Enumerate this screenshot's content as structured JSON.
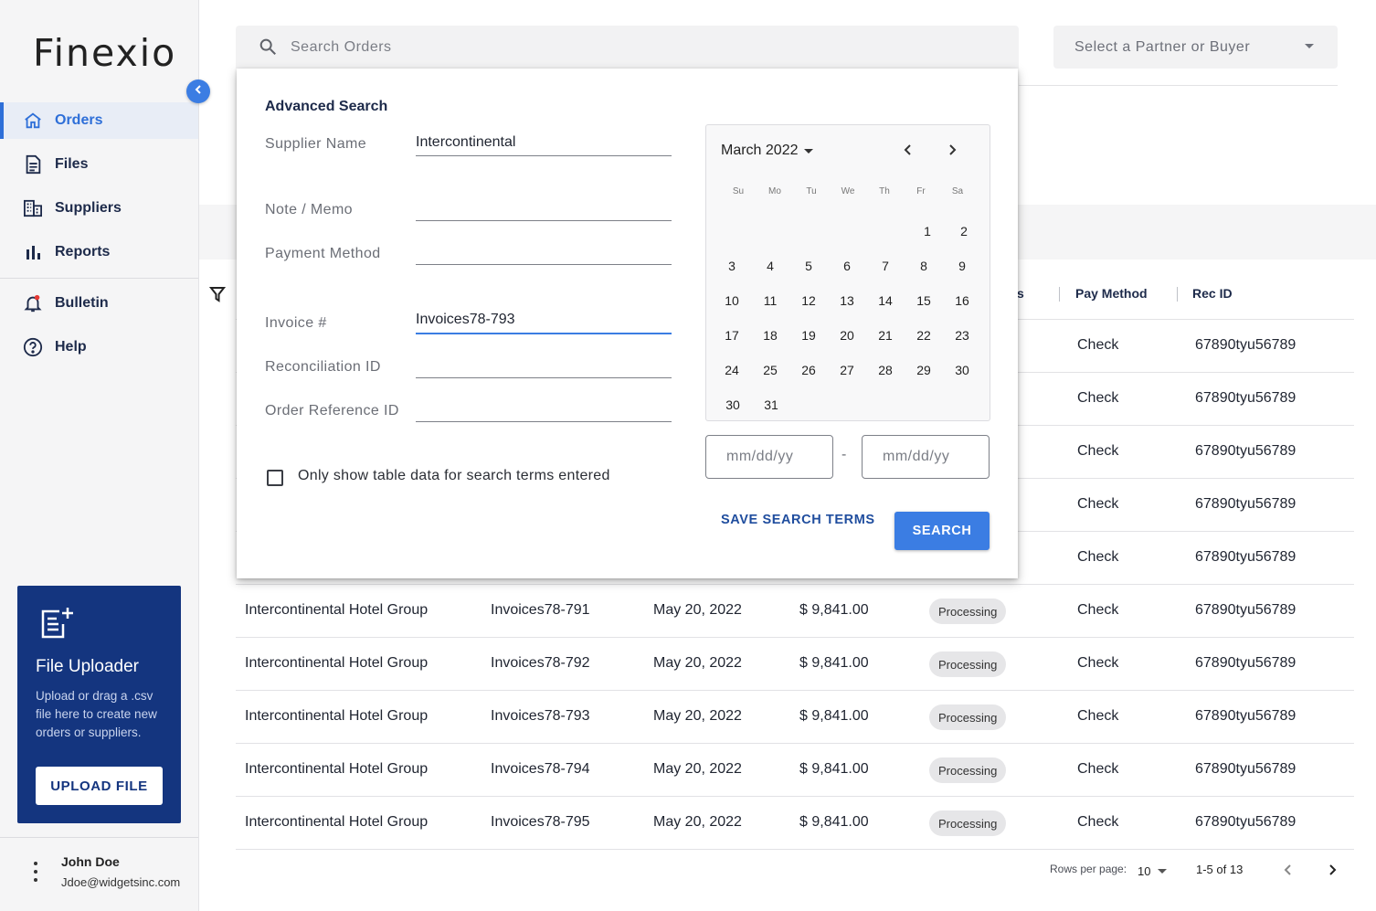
{
  "app": {
    "logo": "Finexio"
  },
  "sidebar": {
    "items": [
      {
        "label": "Orders",
        "icon": "home-icon"
      },
      {
        "label": "Files",
        "icon": "file-icon"
      },
      {
        "label": "Suppliers",
        "icon": "building-icon"
      },
      {
        "label": "Reports",
        "icon": "bar-chart-icon"
      },
      {
        "label": "Bulletin",
        "icon": "bell-icon"
      },
      {
        "label": "Help",
        "icon": "help-icon"
      }
    ],
    "active": "Orders"
  },
  "uploader": {
    "title": "File Uploader",
    "description": "Upload or drag a .csv file here to create new orders or suppliers.",
    "button": "UPLOAD FILE"
  },
  "user": {
    "name": "John Doe",
    "email": "Jdoe@widgetsinc.com"
  },
  "search": {
    "placeholder": "Search Orders"
  },
  "partner": {
    "placeholder": "Select a Partner or Buyer"
  },
  "table": {
    "headers": [
      "s",
      "Pay Method",
      "Rec ID"
    ],
    "partial_rows": [
      {
        "pay_method": "Check",
        "rec_id": "67890tyu56789"
      },
      {
        "pay_method": "Check",
        "rec_id": "67890tyu56789"
      },
      {
        "pay_method": "Check",
        "rec_id": "67890tyu56789"
      },
      {
        "pay_method": "Check",
        "rec_id": "67890tyu56789"
      },
      {
        "pay_method": "Check",
        "rec_id": "67890tyu56789"
      }
    ],
    "rows": [
      {
        "supplier": "Intercontinental Hotel Group",
        "invoice": "Invoices78-791",
        "date": "May 20, 2022",
        "amount": "$ 9,841.00",
        "status": "Processing",
        "pay_method": "Check",
        "rec_id": "67890tyu56789"
      },
      {
        "supplier": "Intercontinental Hotel Group",
        "invoice": "Invoices78-792",
        "date": "May 20, 2022",
        "amount": "$ 9,841.00",
        "status": "Processing",
        "pay_method": "Check",
        "rec_id": "67890tyu56789"
      },
      {
        "supplier": "Intercontinental Hotel Group",
        "invoice": "Invoices78-793",
        "date": "May 20, 2022",
        "amount": "$ 9,841.00",
        "status": "Processing",
        "pay_method": "Check",
        "rec_id": "67890tyu56789"
      },
      {
        "supplier": "Intercontinental Hotel Group",
        "invoice": "Invoices78-794",
        "date": "May 20, 2022",
        "amount": "$ 9,841.00",
        "status": "Processing",
        "pay_method": "Check",
        "rec_id": "67890tyu56789"
      },
      {
        "supplier": "Intercontinental Hotel Group",
        "invoice": "Invoices78-795",
        "date": "May 20, 2022",
        "amount": "$ 9,841.00",
        "status": "Processing",
        "pay_method": "Check",
        "rec_id": "67890tyu56789"
      }
    ]
  },
  "pagination": {
    "rows_label": "Rows per page:",
    "rows_value": "10",
    "range": "1-5 of 13"
  },
  "advanced": {
    "title": "Advanced Search",
    "fields": [
      {
        "label": "Supplier Name",
        "value": "Intercontinental"
      },
      {
        "label": "Note / Memo",
        "value": ""
      },
      {
        "label": "Payment Method",
        "value": ""
      },
      {
        "label": "Invoice #",
        "value": "Invoices78-793"
      },
      {
        "label": "Reconciliation ID",
        "value": ""
      },
      {
        "label": "Order Reference ID",
        "value": ""
      }
    ],
    "checkbox_label": "Only show table data for search terms entered",
    "calendar": {
      "month": "March 2022",
      "weekdays": [
        "Su",
        "Mo",
        "Tu",
        "We",
        "Th",
        "Fr",
        "Sa"
      ],
      "days": [
        "1",
        "2",
        "3",
        "4",
        "5",
        "6",
        "7",
        "8",
        "9",
        "10",
        "11",
        "12",
        "13",
        "14",
        "15",
        "16",
        "17",
        "18",
        "19",
        "20",
        "21",
        "22",
        "23",
        "24",
        "25",
        "26",
        "27",
        "28",
        "29",
        "30",
        "31"
      ]
    },
    "date_from_placeholder": "mm/dd/yy",
    "date_to_placeholder": "mm/dd/yy",
    "date_separator": "-",
    "save_label": "SAVE SEARCH TERMS",
    "search_label": "SEARCH"
  }
}
